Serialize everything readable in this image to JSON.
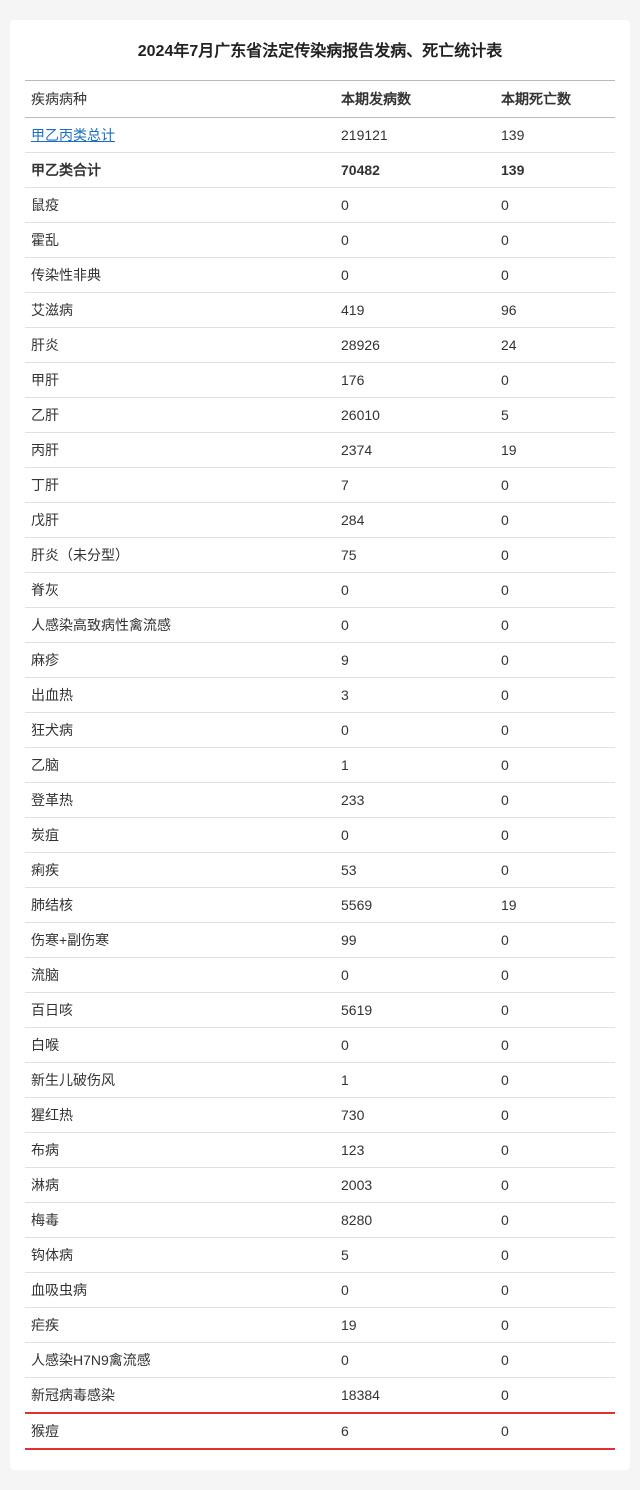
{
  "title": "2024年7月广东省法定传染病报告发病、死亡统计表",
  "headers": {
    "disease": "疾病病种",
    "cases": "本期发病数",
    "deaths": "本期死亡数"
  },
  "rows": [
    {
      "disease": "甲乙丙类总计",
      "cases": "219121",
      "deaths": "139",
      "link": true,
      "bold": false,
      "redBottom": false
    },
    {
      "disease": "甲乙类合计",
      "cases": "70482",
      "deaths": "139",
      "link": false,
      "bold": true,
      "redBottom": false
    },
    {
      "disease": "鼠疫",
      "cases": "0",
      "deaths": "0",
      "link": false,
      "bold": false,
      "redBottom": false
    },
    {
      "disease": "霍乱",
      "cases": "0",
      "deaths": "0",
      "link": false,
      "bold": false,
      "redBottom": false
    },
    {
      "disease": "传染性非典",
      "cases": "0",
      "deaths": "0",
      "link": false,
      "bold": false,
      "redBottom": false
    },
    {
      "disease": "艾滋病",
      "cases": "419",
      "deaths": "96",
      "link": false,
      "bold": false,
      "redBottom": false
    },
    {
      "disease": "肝炎",
      "cases": "28926",
      "deaths": "24",
      "link": false,
      "bold": false,
      "redBottom": false
    },
    {
      "disease": "甲肝",
      "cases": "176",
      "deaths": "0",
      "link": false,
      "bold": false,
      "redBottom": false
    },
    {
      "disease": "乙肝",
      "cases": "26010",
      "deaths": "5",
      "link": false,
      "bold": false,
      "redBottom": false
    },
    {
      "disease": "丙肝",
      "cases": "2374",
      "deaths": "19",
      "link": false,
      "bold": false,
      "redBottom": false
    },
    {
      "disease": "丁肝",
      "cases": "7",
      "deaths": "0",
      "link": false,
      "bold": false,
      "redBottom": false
    },
    {
      "disease": "戊肝",
      "cases": "284",
      "deaths": "0",
      "link": false,
      "bold": false,
      "redBottom": false
    },
    {
      "disease": "肝炎（未分型）",
      "cases": "75",
      "deaths": "0",
      "link": false,
      "bold": false,
      "redBottom": false
    },
    {
      "disease": "脊灰",
      "cases": "0",
      "deaths": "0",
      "link": false,
      "bold": false,
      "redBottom": false
    },
    {
      "disease": "人感染高致病性禽流感",
      "cases": "0",
      "deaths": "0",
      "link": false,
      "bold": false,
      "redBottom": false
    },
    {
      "disease": "麻疹",
      "cases": "9",
      "deaths": "0",
      "link": false,
      "bold": false,
      "redBottom": false
    },
    {
      "disease": "出血热",
      "cases": "3",
      "deaths": "0",
      "link": false,
      "bold": false,
      "redBottom": false
    },
    {
      "disease": "狂犬病",
      "cases": "0",
      "deaths": "0",
      "link": false,
      "bold": false,
      "redBottom": false
    },
    {
      "disease": "乙脑",
      "cases": "1",
      "deaths": "0",
      "link": false,
      "bold": false,
      "redBottom": false
    },
    {
      "disease": "登革热",
      "cases": "233",
      "deaths": "0",
      "link": false,
      "bold": false,
      "redBottom": false
    },
    {
      "disease": "炭疽",
      "cases": "0",
      "deaths": "0",
      "link": false,
      "bold": false,
      "redBottom": false
    },
    {
      "disease": "痢疾",
      "cases": "53",
      "deaths": "0",
      "link": false,
      "bold": false,
      "redBottom": false
    },
    {
      "disease": "肺结核",
      "cases": "5569",
      "deaths": "19",
      "link": false,
      "bold": false,
      "redBottom": false
    },
    {
      "disease": "伤寒+副伤寒",
      "cases": "99",
      "deaths": "0",
      "link": false,
      "bold": false,
      "redBottom": false
    },
    {
      "disease": "流脑",
      "cases": "0",
      "deaths": "0",
      "link": false,
      "bold": false,
      "redBottom": false
    },
    {
      "disease": "百日咳",
      "cases": "5619",
      "deaths": "0",
      "link": false,
      "bold": false,
      "redBottom": false
    },
    {
      "disease": "白喉",
      "cases": "0",
      "deaths": "0",
      "link": false,
      "bold": false,
      "redBottom": false
    },
    {
      "disease": "新生儿破伤风",
      "cases": "1",
      "deaths": "0",
      "link": false,
      "bold": false,
      "redBottom": false
    },
    {
      "disease": "猩红热",
      "cases": "730",
      "deaths": "0",
      "link": false,
      "bold": false,
      "redBottom": false
    },
    {
      "disease": "布病",
      "cases": "123",
      "deaths": "0",
      "link": false,
      "bold": false,
      "redBottom": false
    },
    {
      "disease": "淋病",
      "cases": "2003",
      "deaths": "0",
      "link": false,
      "bold": false,
      "redBottom": false
    },
    {
      "disease": "梅毒",
      "cases": "8280",
      "deaths": "0",
      "link": false,
      "bold": false,
      "redBottom": false
    },
    {
      "disease": "钩体病",
      "cases": "5",
      "deaths": "0",
      "link": false,
      "bold": false,
      "redBottom": false
    },
    {
      "disease": "血吸虫病",
      "cases": "0",
      "deaths": "0",
      "link": false,
      "bold": false,
      "redBottom": false
    },
    {
      "disease": "疟疾",
      "cases": "19",
      "deaths": "0",
      "link": false,
      "bold": false,
      "redBottom": false
    },
    {
      "disease": "人感染H7N9禽流感",
      "cases": "0",
      "deaths": "0",
      "link": false,
      "bold": false,
      "redBottom": false
    },
    {
      "disease": "新冠病毒感染",
      "cases": "18384",
      "deaths": "0",
      "link": false,
      "bold": false,
      "redBottom": true
    },
    {
      "disease": "猴痘",
      "cases": "6",
      "deaths": "0",
      "link": false,
      "bold": false,
      "redBottom": false
    }
  ]
}
